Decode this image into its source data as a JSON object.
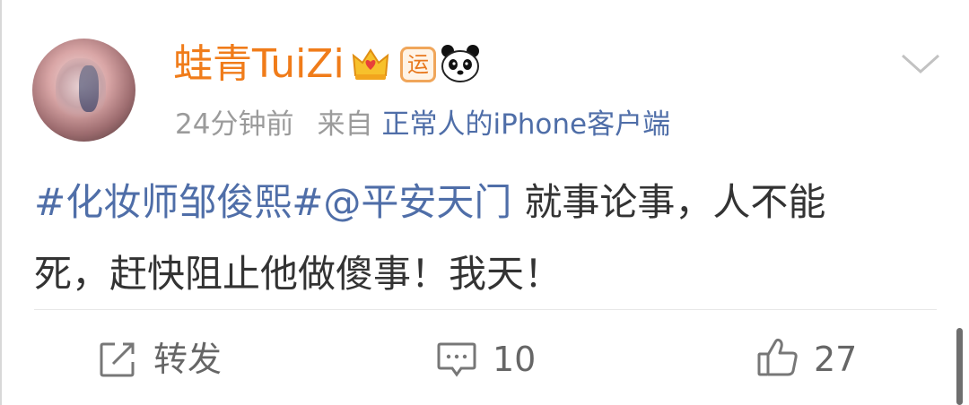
{
  "post": {
    "user": {
      "name": "蛙青TuiZi",
      "badge_text": "运"
    },
    "meta": {
      "time": "24分钟前",
      "from_label": "来自",
      "source": "正常人的iPhone客户端"
    },
    "content": {
      "topic": "#化妆师邹俊熙#",
      "mention": "@平安天门",
      "text_line1": "就事论事，人不能",
      "text_line2": "死，赶快阻止他做傻事！我天！"
    },
    "actions": {
      "repost_label": "转发",
      "comment_count": "10",
      "like_count": "27"
    }
  },
  "icons": {
    "username_badges": [
      "crown-icon",
      "yun-badge-icon",
      "panda-icon"
    ],
    "menu": "chevron-down-icon",
    "repost": "repost-icon",
    "comment": "comment-icon",
    "like": "thumbs-up-icon"
  },
  "colors": {
    "username": "#f07c1a",
    "link": "#4f6ea8",
    "meta": "#9b9b9b",
    "body_text": "#333333",
    "action_text": "#666666"
  }
}
